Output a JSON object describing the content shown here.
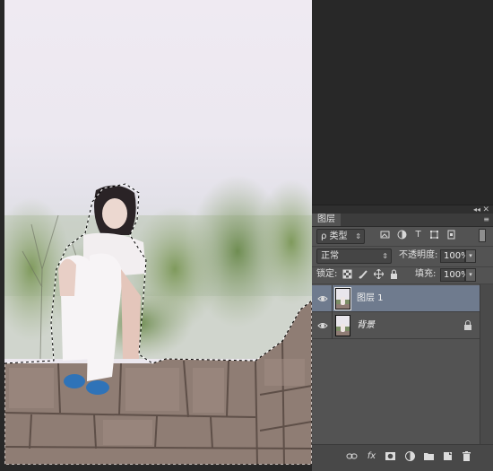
{
  "panel": {
    "tab_label": "图层",
    "collapse_glyph": "◂◂",
    "close_glyph": "✕",
    "menu_glyph": "≡"
  },
  "filter": {
    "kind_label": "ρ 类型",
    "icons": [
      "image-filter-icon",
      "adjustment-filter-icon",
      "type-filter-icon",
      "shape-filter-icon",
      "smart-object-filter-icon"
    ]
  },
  "blend": {
    "mode": "正常",
    "opacity_label": "不透明度:",
    "opacity_value": "100%"
  },
  "lock": {
    "label": "锁定:",
    "fill_label": "填充:",
    "fill_value": "100%"
  },
  "layers": [
    {
      "name": "图层 1",
      "selected": true,
      "visible": true,
      "locked": false
    },
    {
      "name": "背景",
      "selected": false,
      "visible": true,
      "locked": true
    }
  ],
  "bottom_icons": [
    "link-layers-icon",
    "fx-icon",
    "add-mask-icon",
    "adjustment-layer-icon",
    "new-group-icon",
    "new-layer-icon",
    "delete-layer-icon"
  ],
  "colors": {
    "panel_bg": "#535353",
    "selected_layer": "#6f7b8e",
    "workspace_bg": "#282828"
  }
}
